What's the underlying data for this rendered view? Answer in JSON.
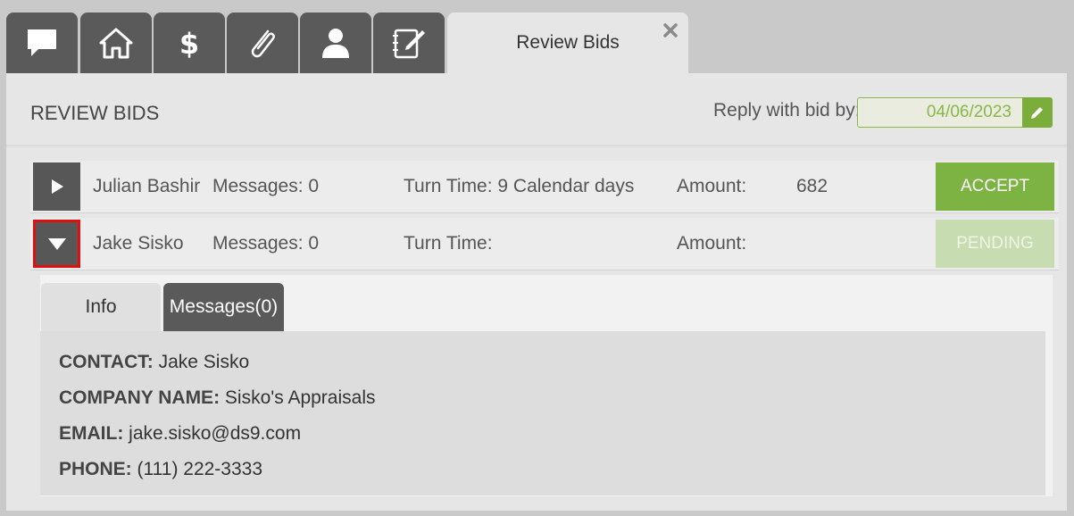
{
  "tabs": {
    "icon_tabs": [
      "chat-icon",
      "home-icon",
      "dollar-icon",
      "paperclip-icon",
      "person-icon",
      "notepad-icon"
    ],
    "active_tab_label": "Review Bids",
    "close_icon": "close-icon"
  },
  "header": {
    "title": "REVIEW BIDS",
    "reply_label": "Reply with bid by:",
    "reply_date": "04/06/2023"
  },
  "bids": [
    {
      "name": "Julian Bashir",
      "messages": "Messages: 0",
      "turn_time": "Turn Time: 9 Calendar days",
      "amount_label": "Amount:",
      "amount": "682",
      "action": "ACCEPT",
      "expanded": false
    },
    {
      "name": "Jake Sisko",
      "messages": "Messages: 0",
      "turn_time": "Turn Time:",
      "amount_label": "Amount:",
      "amount": "",
      "action": "PENDING",
      "expanded": true
    }
  ],
  "detail": {
    "tabs": [
      "Info",
      "Messages(0)"
    ],
    "contact_label": "CONTACT:",
    "contact": "Jake Sisko",
    "company_label": "COMPANY NAME:",
    "company": "Sisko's Appraisals",
    "email_label": "EMAIL:",
    "email": "jake.sisko@ds9.com",
    "phone_label": "PHONE:",
    "phone": "(111) 222-3333"
  },
  "colors": {
    "accent_green": "#7cb342",
    "pending_green": "#c7dcb0",
    "dark_tab": "#5a5a5a",
    "selection_outline": "#e01010"
  }
}
